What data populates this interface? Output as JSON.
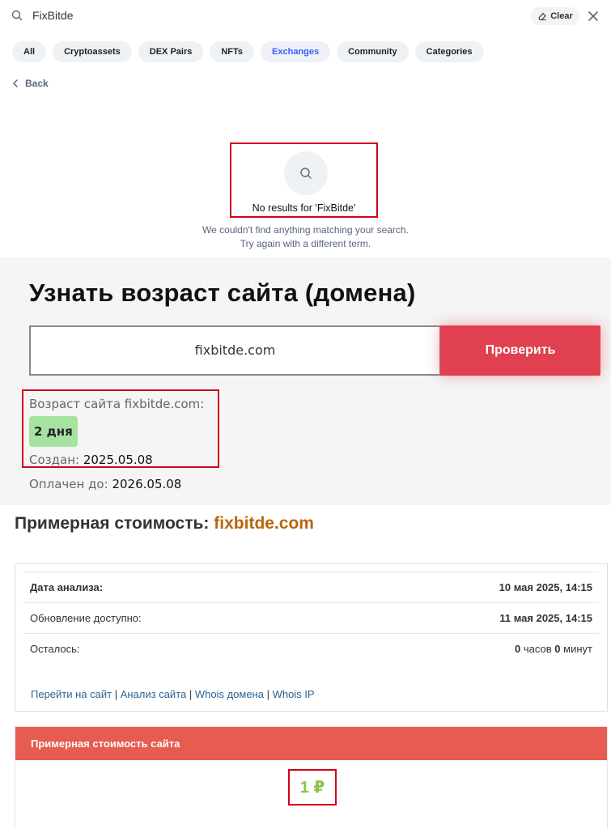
{
  "search": {
    "query": "FixBitde",
    "clear_label": "Clear",
    "filters": [
      "All",
      "Cryptoassets",
      "DEX Pairs",
      "NFTs",
      "Exchanges",
      "Community",
      "Categories"
    ],
    "active_filter": "Exchanges",
    "back_label": "Back",
    "no_results_title": "No results for 'FixBitde'",
    "no_results_line1": "We couldn't find anything matching your search.",
    "no_results_line2": "Try again with a different term."
  },
  "age_checker": {
    "title": "Узнать возраст сайта (домена)",
    "input_value": "fixbitde.com",
    "button_label": "Проверить",
    "age_label": "Возраст сайта fixbitde.com:",
    "age_value": "2 дня",
    "created_label": "Создан:",
    "created_value": "2025.05.08",
    "paid_label": "Оплачен до:",
    "paid_value": "2026.05.08"
  },
  "cost": {
    "heading": "Примерная стоимость:",
    "domain": "fixbitde.com",
    "rows": [
      {
        "key": "Дата анализа:",
        "value": "10 мая 2025, 14:15"
      },
      {
        "key": "Обновление доступно:",
        "value": "11 мая 2025, 14:15"
      },
      {
        "key": "Осталось:",
        "hours_num": "0",
        "hours_unit": "часов",
        "mins_num": "0",
        "mins_unit": "минут"
      }
    ],
    "links": [
      "Перейти на сайт",
      "Анализ сайта",
      "Whois домена",
      "Whois IP"
    ],
    "site_cost_header": "Примерная стоимость сайта",
    "price": "1 ₽"
  },
  "colors": {
    "accent_red": "#e0404f",
    "highlight_box": "#d0021b",
    "age_badge": "#a6e3a1",
    "domain_orange": "#b8650a",
    "price_green": "#8bc34a",
    "cost_header": "#e65c50"
  }
}
